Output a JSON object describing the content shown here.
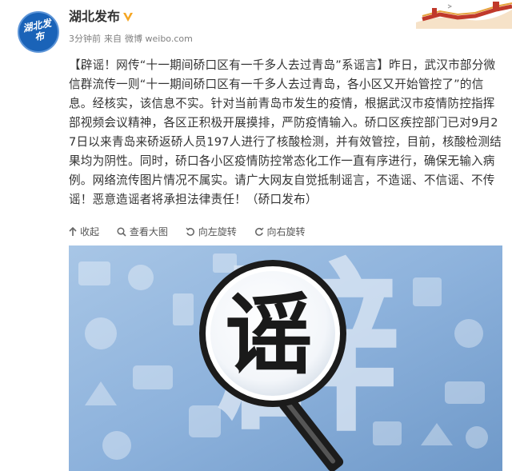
{
  "header": {
    "avatar_label": "湖北发布",
    "username": "湖北发布",
    "time": "3分钟前",
    "source_prefix": "来自",
    "source": "微博 weibo.com"
  },
  "post": {
    "text": "【辟谣！网传“十一期间硚口区有一千多人去过青岛”系谣言】昨日，武汉市部分微信群流传一则“十一期间硚口区有一千多人去过青岛，各小区又开始管控了”的信息。经核实，该信息不实。针对当前青岛市发生的疫情，根据武汉市疫情防控指挥部视频会议精神，各区正积极开展摸排，严防疫情输入。硚口区疾控部门已对9月27日以来青岛来硚返硚人员197人进行了核酸检测，并有效管控，目前，核酸检测结果均为阴性。同时，硚口各小区疫情防控常态化工作一直有序进行，确保无输入病例。网络流传图片情况不属实。请广大网友自觉抵制谣言，不造谣、不信谣、不传谣！恶意造谣者将承担法律责任！（硚口发布）"
  },
  "actions": {
    "collapse": "收起",
    "view_large": "查看大图",
    "rotate_left": "向左旋转",
    "rotate_right": "向右旋转"
  },
  "image": {
    "main_glyph": "谣",
    "bg_glyph": "辟"
  },
  "colors": {
    "text": "#333333",
    "meta": "#808080",
    "verified": "#f5a623",
    "avatar": "#1a63b8",
    "photo_bg": "#8fb3da"
  },
  "icons": [
    "verified-icon",
    "collapse-arrow-icon",
    "magnifier-icon",
    "rotate-left-icon",
    "rotate-right-icon"
  ]
}
